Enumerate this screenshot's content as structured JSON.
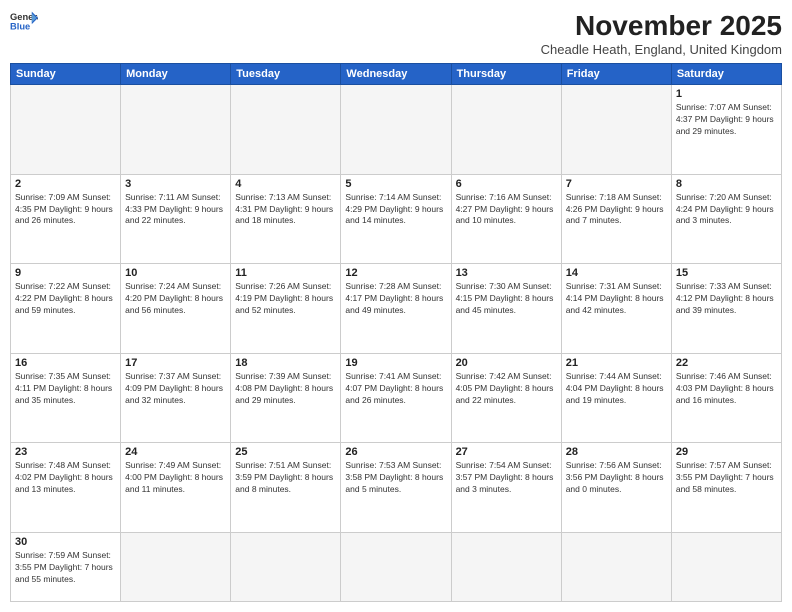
{
  "logo": {
    "line1": "General",
    "line2": "Blue"
  },
  "title": "November 2025",
  "location": "Cheadle Heath, England, United Kingdom",
  "days_of_week": [
    "Sunday",
    "Monday",
    "Tuesday",
    "Wednesday",
    "Thursday",
    "Friday",
    "Saturday"
  ],
  "weeks": [
    [
      {
        "day": "",
        "info": ""
      },
      {
        "day": "",
        "info": ""
      },
      {
        "day": "",
        "info": ""
      },
      {
        "day": "",
        "info": ""
      },
      {
        "day": "",
        "info": ""
      },
      {
        "day": "",
        "info": ""
      },
      {
        "day": "1",
        "info": "Sunrise: 7:07 AM\nSunset: 4:37 PM\nDaylight: 9 hours and 29 minutes."
      }
    ],
    [
      {
        "day": "2",
        "info": "Sunrise: 7:09 AM\nSunset: 4:35 PM\nDaylight: 9 hours and 26 minutes."
      },
      {
        "day": "3",
        "info": "Sunrise: 7:11 AM\nSunset: 4:33 PM\nDaylight: 9 hours and 22 minutes."
      },
      {
        "day": "4",
        "info": "Sunrise: 7:13 AM\nSunset: 4:31 PM\nDaylight: 9 hours and 18 minutes."
      },
      {
        "day": "5",
        "info": "Sunrise: 7:14 AM\nSunset: 4:29 PM\nDaylight: 9 hours and 14 minutes."
      },
      {
        "day": "6",
        "info": "Sunrise: 7:16 AM\nSunset: 4:27 PM\nDaylight: 9 hours and 10 minutes."
      },
      {
        "day": "7",
        "info": "Sunrise: 7:18 AM\nSunset: 4:26 PM\nDaylight: 9 hours and 7 minutes."
      },
      {
        "day": "8",
        "info": "Sunrise: 7:20 AM\nSunset: 4:24 PM\nDaylight: 9 hours and 3 minutes."
      }
    ],
    [
      {
        "day": "9",
        "info": "Sunrise: 7:22 AM\nSunset: 4:22 PM\nDaylight: 8 hours and 59 minutes."
      },
      {
        "day": "10",
        "info": "Sunrise: 7:24 AM\nSunset: 4:20 PM\nDaylight: 8 hours and 56 minutes."
      },
      {
        "day": "11",
        "info": "Sunrise: 7:26 AM\nSunset: 4:19 PM\nDaylight: 8 hours and 52 minutes."
      },
      {
        "day": "12",
        "info": "Sunrise: 7:28 AM\nSunset: 4:17 PM\nDaylight: 8 hours and 49 minutes."
      },
      {
        "day": "13",
        "info": "Sunrise: 7:30 AM\nSunset: 4:15 PM\nDaylight: 8 hours and 45 minutes."
      },
      {
        "day": "14",
        "info": "Sunrise: 7:31 AM\nSunset: 4:14 PM\nDaylight: 8 hours and 42 minutes."
      },
      {
        "day": "15",
        "info": "Sunrise: 7:33 AM\nSunset: 4:12 PM\nDaylight: 8 hours and 39 minutes."
      }
    ],
    [
      {
        "day": "16",
        "info": "Sunrise: 7:35 AM\nSunset: 4:11 PM\nDaylight: 8 hours and 35 minutes."
      },
      {
        "day": "17",
        "info": "Sunrise: 7:37 AM\nSunset: 4:09 PM\nDaylight: 8 hours and 32 minutes."
      },
      {
        "day": "18",
        "info": "Sunrise: 7:39 AM\nSunset: 4:08 PM\nDaylight: 8 hours and 29 minutes."
      },
      {
        "day": "19",
        "info": "Sunrise: 7:41 AM\nSunset: 4:07 PM\nDaylight: 8 hours and 26 minutes."
      },
      {
        "day": "20",
        "info": "Sunrise: 7:42 AM\nSunset: 4:05 PM\nDaylight: 8 hours and 22 minutes."
      },
      {
        "day": "21",
        "info": "Sunrise: 7:44 AM\nSunset: 4:04 PM\nDaylight: 8 hours and 19 minutes."
      },
      {
        "day": "22",
        "info": "Sunrise: 7:46 AM\nSunset: 4:03 PM\nDaylight: 8 hours and 16 minutes."
      }
    ],
    [
      {
        "day": "23",
        "info": "Sunrise: 7:48 AM\nSunset: 4:02 PM\nDaylight: 8 hours and 13 minutes."
      },
      {
        "day": "24",
        "info": "Sunrise: 7:49 AM\nSunset: 4:00 PM\nDaylight: 8 hours and 11 minutes."
      },
      {
        "day": "25",
        "info": "Sunrise: 7:51 AM\nSunset: 3:59 PM\nDaylight: 8 hours and 8 minutes."
      },
      {
        "day": "26",
        "info": "Sunrise: 7:53 AM\nSunset: 3:58 PM\nDaylight: 8 hours and 5 minutes."
      },
      {
        "day": "27",
        "info": "Sunrise: 7:54 AM\nSunset: 3:57 PM\nDaylight: 8 hours and 3 minutes."
      },
      {
        "day": "28",
        "info": "Sunrise: 7:56 AM\nSunset: 3:56 PM\nDaylight: 8 hours and 0 minutes."
      },
      {
        "day": "29",
        "info": "Sunrise: 7:57 AM\nSunset: 3:55 PM\nDaylight: 7 hours and 58 minutes."
      }
    ],
    [
      {
        "day": "30",
        "info": "Sunrise: 7:59 AM\nSunset: 3:55 PM\nDaylight: 7 hours and 55 minutes."
      },
      {
        "day": "",
        "info": ""
      },
      {
        "day": "",
        "info": ""
      },
      {
        "day": "",
        "info": ""
      },
      {
        "day": "",
        "info": ""
      },
      {
        "day": "",
        "info": ""
      },
      {
        "day": "",
        "info": ""
      }
    ]
  ]
}
